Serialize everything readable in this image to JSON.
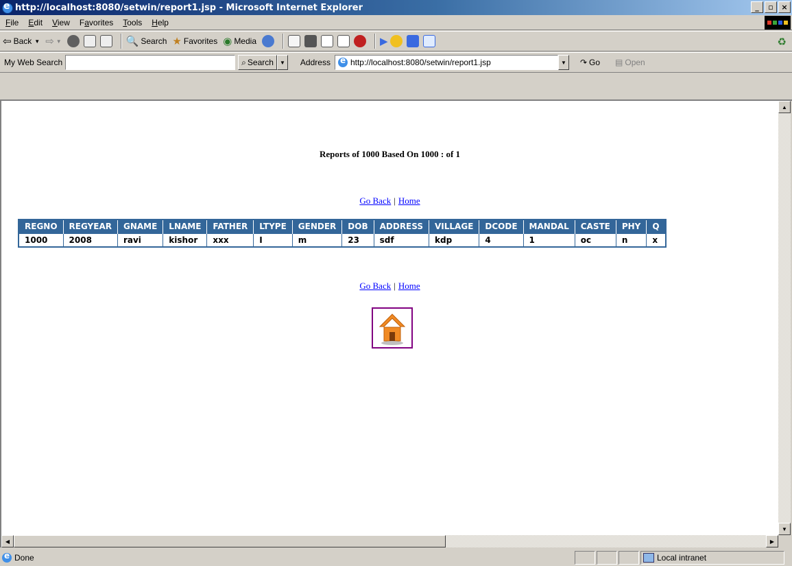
{
  "window": {
    "title": "http://localhost:8080/setwin/report1.jsp - Microsoft Internet Explorer",
    "minimize": "_",
    "maximize": "▫",
    "close": "×"
  },
  "menu": {
    "items": [
      {
        "prefix": "",
        "key": "F",
        "rest": "ile"
      },
      {
        "prefix": "",
        "key": "E",
        "rest": "dit"
      },
      {
        "prefix": "",
        "key": "V",
        "rest": "iew"
      },
      {
        "prefix": "F",
        "key": "a",
        "rest": "vorites"
      },
      {
        "prefix": "",
        "key": "T",
        "rest": "ools"
      },
      {
        "prefix": "",
        "key": "H",
        "rest": "elp"
      }
    ]
  },
  "toolbar": {
    "back_label": "Back",
    "search_label": "Search",
    "favorites_label": "Favorites",
    "media_label": "Media"
  },
  "addressbar": {
    "web_search_label": "My Web Search",
    "search_value": "",
    "search_button": "Search",
    "address_label": "Address",
    "url": "http://localhost:8080/setwin/report1.jsp",
    "go_label": "Go",
    "open_label": "Open"
  },
  "report": {
    "title": "Reports of 1000 Based On 1000  : of 1",
    "go_back": "Go Back",
    "separator": "|",
    "home": "Home",
    "columns": [
      "REGNO",
      "REGYEAR",
      "GNAME",
      "LNAME",
      "FATHER",
      "LTYPE",
      "GENDER",
      "DOB",
      "ADDRESS",
      "VILLAGE",
      "DCODE",
      "MANDAL",
      "CASTE",
      "PHY",
      "Q"
    ],
    "rows": [
      [
        "1000",
        "2008",
        "ravi",
        "kishor",
        "xxx",
        "I",
        "m",
        "23",
        "sdf",
        "kdp",
        "4",
        "1",
        "oc",
        "n",
        "x"
      ]
    ]
  },
  "status": {
    "text": "Done",
    "zone": "Local intranet"
  },
  "colors": {
    "table_header": "#336699",
    "link": "#0000ff",
    "home_icon_border": "#800080",
    "home_icon_fill": "#f08a24"
  }
}
